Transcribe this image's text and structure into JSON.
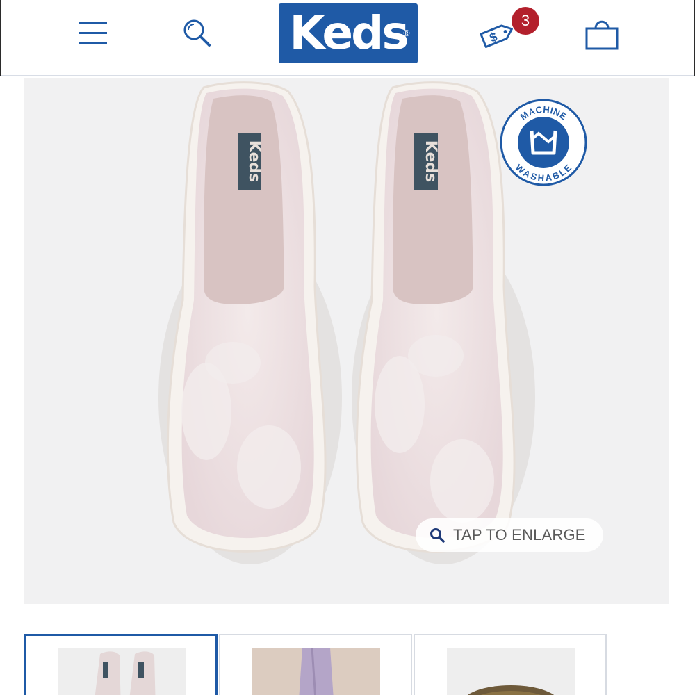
{
  "header": {
    "logo_text": "Keds",
    "logo_registered": "®",
    "deals_count": "3",
    "icons": [
      "menu-icon",
      "search-icon",
      "price-tag-icon",
      "shopping-bag-icon"
    ],
    "brand_color": "#1f5aa6",
    "badge_color": "#b3202c"
  },
  "hero": {
    "badge_top_text": "MACHINE",
    "badge_bottom_text": "WASHABLE",
    "insole_brand": "Keds",
    "enlarge_label": "TAP TO ENLARGE"
  },
  "thumbnails": [
    {
      "name": "top-view",
      "active": true
    },
    {
      "name": "on-foot",
      "active": false
    },
    {
      "name": "sole",
      "active": false
    }
  ]
}
